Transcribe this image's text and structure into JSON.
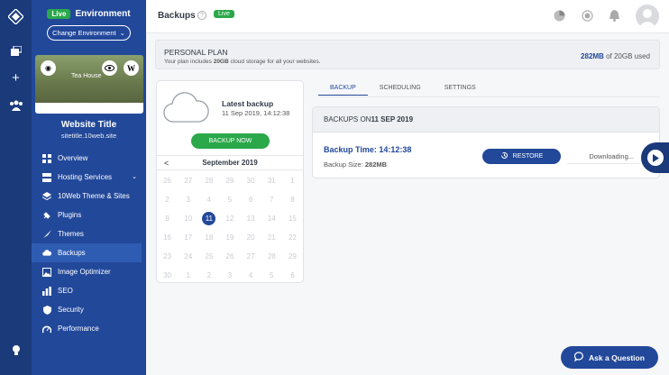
{
  "sidebar": {
    "env_badge": "Live",
    "env_title": "Environment",
    "change_env": "Change Environment",
    "thumb_text": "Tea House",
    "site_title": "Website Title",
    "site_url": "sitetitle.10web.site",
    "items": [
      {
        "label": "Overview",
        "icon": "grid-icon"
      },
      {
        "label": "Hosting Services",
        "icon": "server-icon"
      },
      {
        "label": "10Web Theme & Sites",
        "icon": "layers-icon"
      },
      {
        "label": "Plugins",
        "icon": "plug-icon"
      },
      {
        "label": "Themes",
        "icon": "brush-icon"
      },
      {
        "label": "Backups",
        "icon": "cloud-upload-icon"
      },
      {
        "label": "Image Optimizer",
        "icon": "image-icon"
      },
      {
        "label": "SEO",
        "icon": "bar-chart-icon"
      },
      {
        "label": "Security",
        "icon": "shield-icon"
      },
      {
        "label": "Performance",
        "icon": "gauge-icon"
      }
    ]
  },
  "header": {
    "title": "Backups",
    "help": "?",
    "live": "Live"
  },
  "plan": {
    "title": "PERSONAL PLAN",
    "desc_pre": "Your plan includes ",
    "desc_bold": "20GB",
    "desc_post": " cloud storage for all your websites.",
    "used": "282MB",
    "total": " of 20GB used"
  },
  "latest": {
    "title": "Latest backup",
    "date": "11 Sep 2019, 14:12:38",
    "button": "BACKUP NOW"
  },
  "calendar": {
    "prev": "<",
    "month": "September 2019",
    "rows": [
      [
        "26",
        "27",
        "28",
        "29",
        "30",
        "31",
        "1"
      ],
      [
        "2",
        "3",
        "4",
        "5",
        "6",
        "7",
        "8"
      ],
      [
        "9",
        "10",
        "11",
        "12",
        "13",
        "14",
        "15"
      ],
      [
        "16",
        "17",
        "18",
        "19",
        "20",
        "21",
        "22"
      ],
      [
        "23",
        "24",
        "25",
        "26",
        "27",
        "28",
        "29"
      ],
      [
        "30",
        "1",
        "2",
        "3",
        "4",
        "5",
        "6"
      ]
    ],
    "selected": "11"
  },
  "tabs": [
    "BACKUP",
    "SCHEDULING",
    "SETTINGS"
  ],
  "backups": {
    "heading_pre": "BACKUPS ON ",
    "heading_date": "11 SEP 2019",
    "time_label": "Backup Time: 14:12:38",
    "size_label": "Backup Size: ",
    "size_value": "282MB",
    "restore": "RESTORE",
    "status": "Downloading..."
  },
  "ask": "Ask a Question",
  "colors": {
    "brand": "#22489a",
    "rail": "#1a3a7a",
    "green": "#2aa84a"
  }
}
